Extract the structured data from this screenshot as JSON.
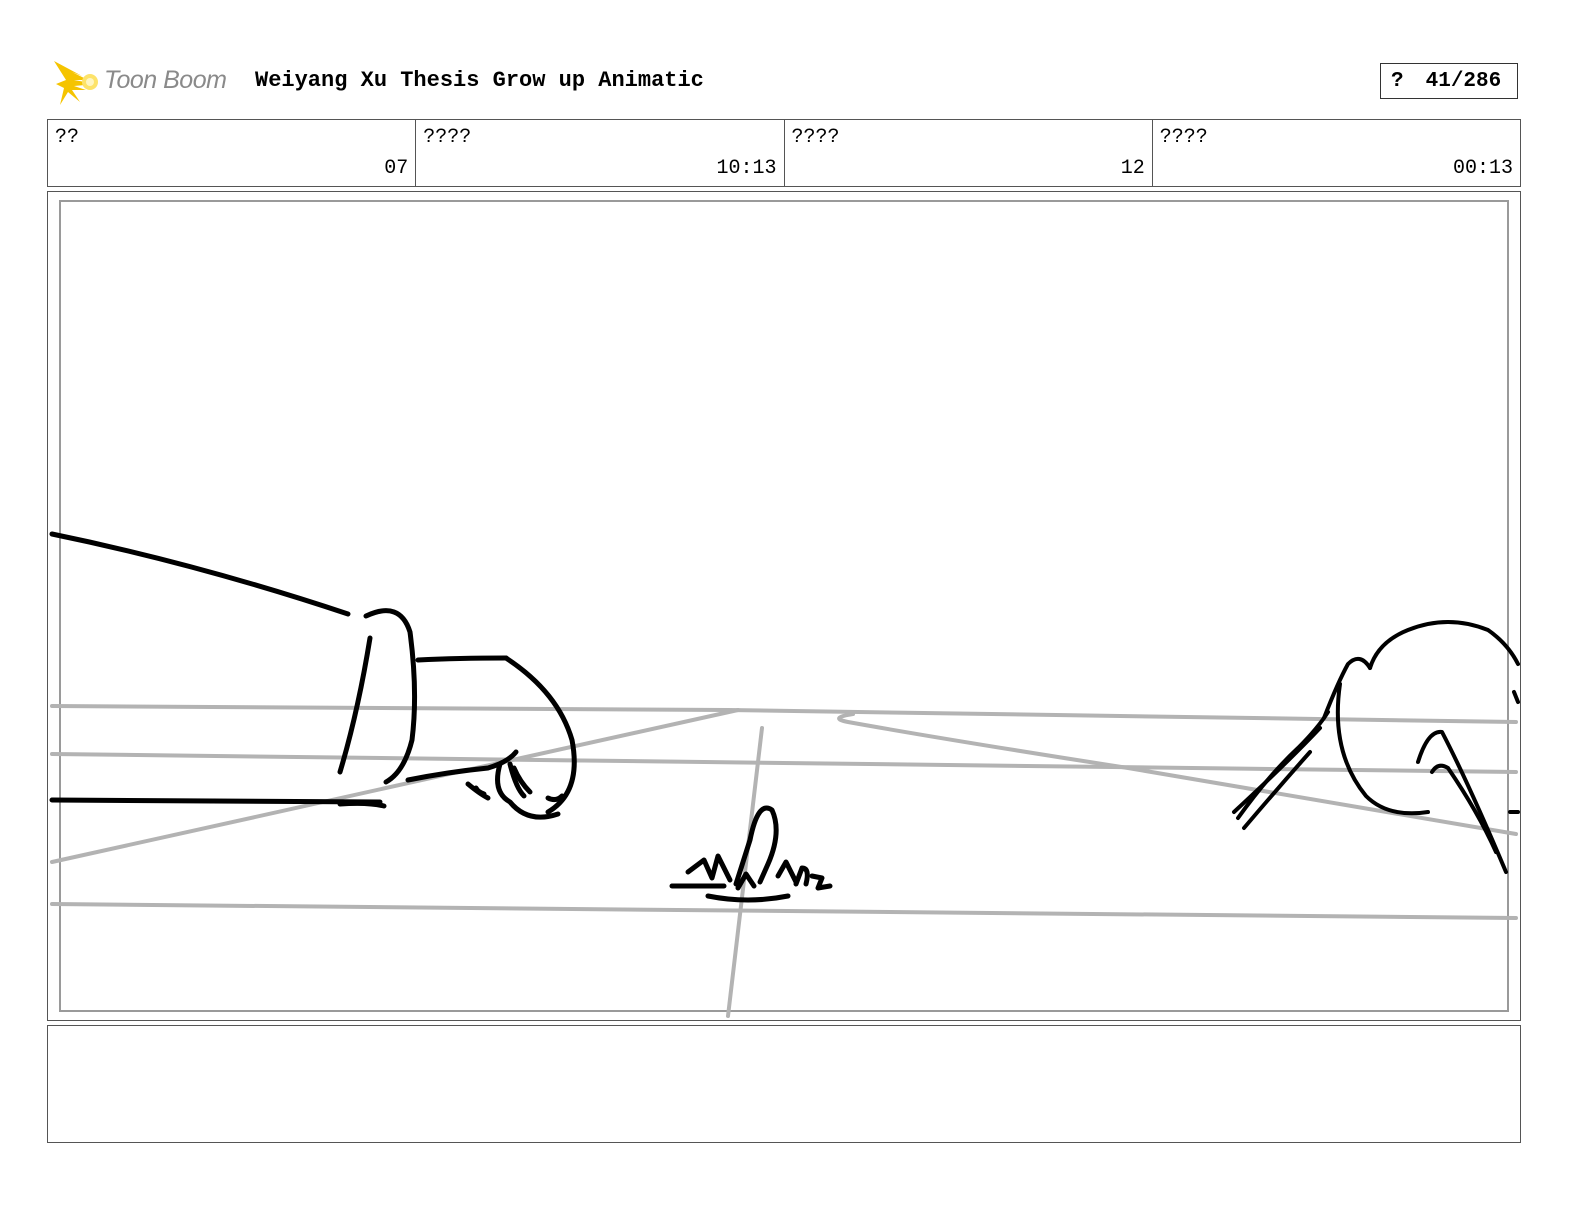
{
  "header": {
    "logo_text": "Toon Boom",
    "title": "Weiyang Xu Thesis Grow up Animatic",
    "page_marker": "?",
    "page_number": "41/286"
  },
  "info": [
    {
      "label": "??",
      "value": "07"
    },
    {
      "label": "????",
      "value": "10:13"
    },
    {
      "label": "????",
      "value": "12"
    },
    {
      "label": "????",
      "value": "00:13"
    }
  ],
  "notes": {
    "text": ""
  }
}
